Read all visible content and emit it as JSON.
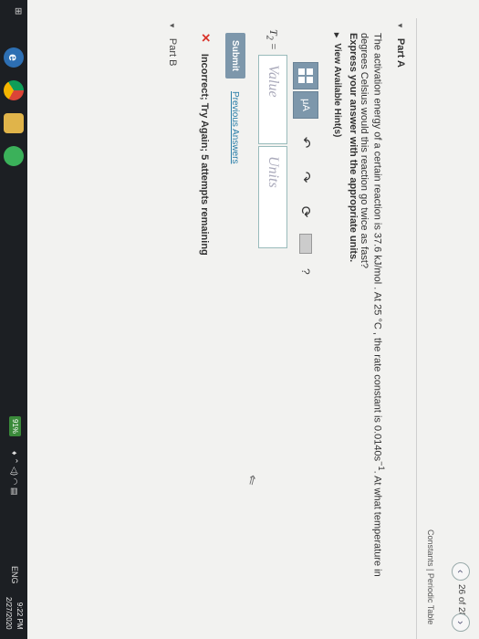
{
  "nav": {
    "prev_icon": "chevron-left-icon",
    "page_count": "26 of 28",
    "next_icon": "chevron-right-icon"
  },
  "links": {
    "constants": "Constants",
    "separator": " | ",
    "periodic_table": "Periodic Table"
  },
  "part_a": {
    "title": "Part A",
    "question_1": "The activation energy of a certain reaction is 37.6 kJ/mol . At 25 °C , the rate constant is 0.0140s",
    "question_exp": "−1",
    "question_2": ". At what temperature in degrees Celsius would this reaction go twice as fast?",
    "express": "Express your answer with the appropriate units.",
    "hints": "View Available Hint(s)"
  },
  "editor": {
    "templates_icon": "templates-icon",
    "units_label": "μA",
    "undo_icon": "undo-icon",
    "redo_icon": "redo-icon",
    "reset_icon": "reset-icon",
    "keyboard_icon": "keyboard-icon",
    "help": "?",
    "variable": "T",
    "variable_sub": "2",
    "equals": " =",
    "value_placeholder": "Value",
    "units_placeholder": "Units"
  },
  "actions": {
    "submit": "Submit",
    "previous_answers": "Previous Answers"
  },
  "feedback": {
    "mark": "✕",
    "message": "Incorrect; Try Again; 5 attempts remaining"
  },
  "part_b": {
    "title": "Part B"
  },
  "taskbar": {
    "battery": "91%",
    "lang": "ENG",
    "time": "9:22 PM",
    "date": "2/27/2020"
  }
}
